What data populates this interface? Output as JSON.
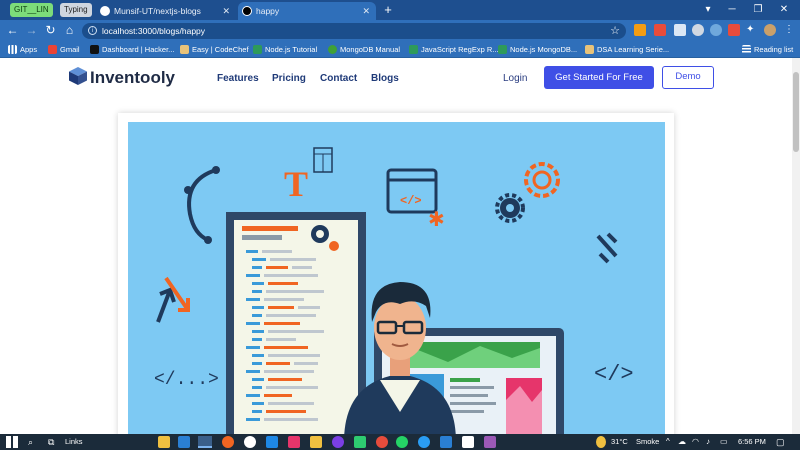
{
  "browser": {
    "pills": [
      "GIT__LIN",
      "Typing"
    ],
    "tabs": [
      {
        "title": "Munsif-UT/nextjs-blogs",
        "active": false,
        "icon": "github-icon"
      },
      {
        "title": "happy",
        "active": true,
        "icon": "nextjs-icon"
      }
    ],
    "new_tab": "+",
    "address": {
      "url": "localhost:3000/blogs/happy"
    },
    "bookmarks": [
      {
        "label": "Apps",
        "icon": "apps-grid-icon",
        "color": "#ffffff"
      },
      {
        "label": "Gmail",
        "icon": "gmail-icon",
        "color": "#ea4335"
      },
      {
        "label": "Dashboard | Hacker...",
        "icon": "hackerrank-icon",
        "color": "#111111"
      },
      {
        "label": "Easy | CodeChef",
        "icon": "codechef-icon",
        "color": "#e8c37a"
      },
      {
        "label": "Node.js Tutorial",
        "icon": "w3schools-icon",
        "color": "#2e9a5a"
      },
      {
        "label": "MongoDB Manual",
        "icon": "mongodb-icon",
        "color": "#3fa037"
      },
      {
        "label": "JavaScript RegExp R...",
        "icon": "w3schools-icon",
        "color": "#2e9a5a"
      },
      {
        "label": "Node.js MongoDB...",
        "icon": "w3schools-icon",
        "color": "#2e9a5a"
      },
      {
        "label": "DSA Learning Serie...",
        "icon": "codechef-icon",
        "color": "#e8c37a"
      }
    ],
    "reading_list": "Reading list"
  },
  "site": {
    "brand": "Inventooly",
    "nav": [
      "Features",
      "Pricing",
      "Contact",
      "Blogs"
    ],
    "login": "Login",
    "cta_primary": "Get Started For Free",
    "cta_secondary": "Demo",
    "accent": "#3f4fe6"
  },
  "taskbar": {
    "search_label": "Links",
    "weather": "31°C",
    "weather_desc": "Smoke",
    "time": "6:56 PM"
  }
}
